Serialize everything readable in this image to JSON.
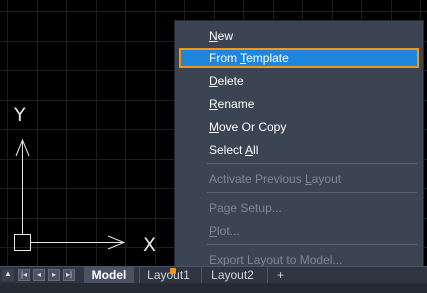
{
  "canvas": {
    "ucs_y_label": "Y",
    "ucs_x_label": "X"
  },
  "context_menu": {
    "items": [
      {
        "pre": "",
        "u": "N",
        "post": "ew",
        "enabled": true,
        "highlighted": false
      },
      {
        "pre": "From ",
        "u": "T",
        "post": "emplate",
        "enabled": true,
        "highlighted": true
      },
      {
        "pre": "",
        "u": "D",
        "post": "elete",
        "enabled": true,
        "highlighted": false
      },
      {
        "pre": "",
        "u": "R",
        "post": "ename",
        "enabled": true,
        "highlighted": false
      },
      {
        "pre": "",
        "u": "M",
        "post": "ove Or Copy",
        "enabled": true,
        "highlighted": false
      },
      {
        "pre": "Select ",
        "u": "A",
        "post": "ll",
        "enabled": true,
        "highlighted": false
      },
      {
        "pre": "Activate Previous ",
        "u": "L",
        "post": "ayout",
        "enabled": false,
        "highlighted": false
      },
      {
        "pre": "Pa",
        "u": "g",
        "post": "e Setup...",
        "enabled": false,
        "highlighted": false
      },
      {
        "pre": "",
        "u": "P",
        "post": "lot...",
        "enabled": false,
        "highlighted": false
      },
      {
        "pre": "Export Layout to Model...",
        "u": "",
        "post": "",
        "enabled": false,
        "highlighted": false
      }
    ]
  },
  "tabbar": {
    "nav_icons": [
      "scroll-up-icon",
      "first-tab-icon",
      "prev-tab-icon",
      "next-tab-icon",
      "last-tab-icon"
    ],
    "tabs": [
      {
        "label": "Model",
        "active": true
      },
      {
        "label": "Layout1",
        "active": false
      },
      {
        "label": "Layout2",
        "active": false
      },
      {
        "label": "+",
        "active": false
      }
    ]
  },
  "colors": {
    "menu_bg": "#3b4452",
    "highlight_bg": "#1e87d9",
    "highlight_border": "#f0951e",
    "canvas_bg": "#000000",
    "grid": "#1c1c1c"
  }
}
